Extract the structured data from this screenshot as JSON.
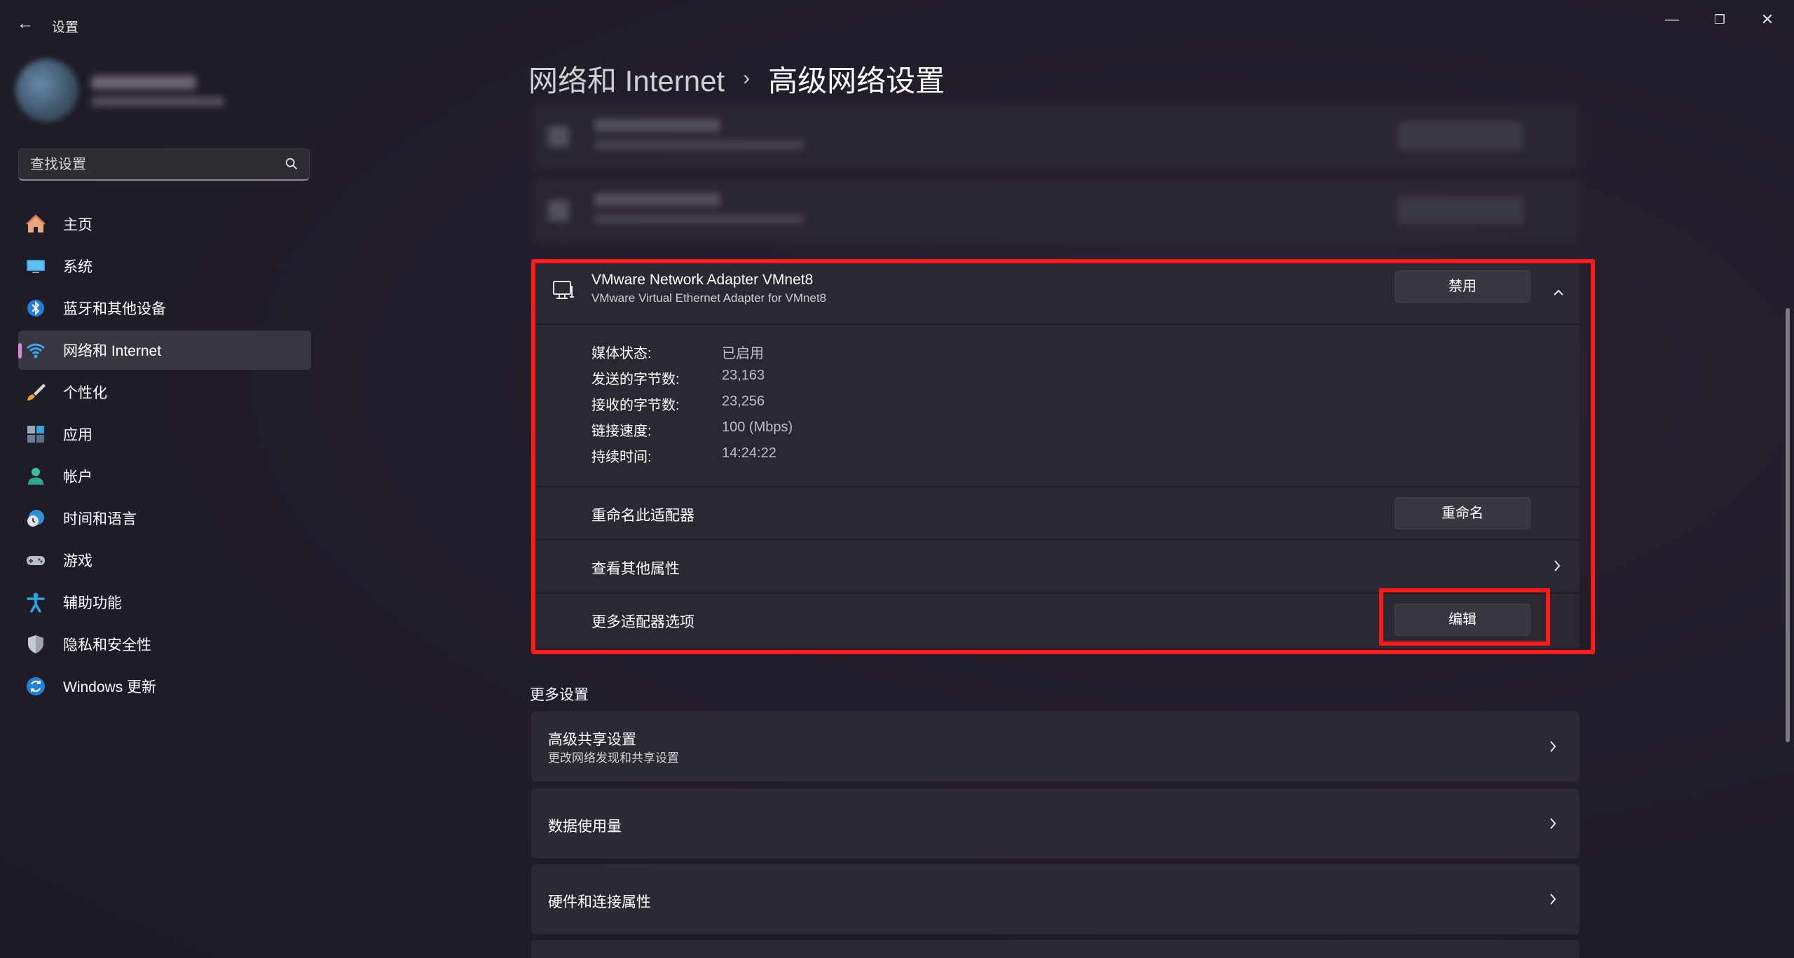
{
  "app": {
    "title": "设置",
    "back_icon": "arrow-left-icon"
  },
  "window_controls": {
    "minimize": "—",
    "maximize": "❐",
    "close": "✕"
  },
  "search": {
    "placeholder": "查找设置"
  },
  "sidebar": {
    "items": [
      {
        "label": "主页",
        "icon": "home-icon"
      },
      {
        "label": "系统",
        "icon": "system-icon"
      },
      {
        "label": "蓝牙和其他设备",
        "icon": "bluetooth-icon"
      },
      {
        "label": "网络和 Internet",
        "icon": "wifi-icon",
        "active": true
      },
      {
        "label": "个性化",
        "icon": "brush-icon"
      },
      {
        "label": "应用",
        "icon": "apps-icon"
      },
      {
        "label": "帐户",
        "icon": "account-icon"
      },
      {
        "label": "时间和语言",
        "icon": "time-language-icon"
      },
      {
        "label": "游戏",
        "icon": "gamepad-icon"
      },
      {
        "label": "辅助功能",
        "icon": "accessibility-icon"
      },
      {
        "label": "隐私和安全性",
        "icon": "shield-icon"
      },
      {
        "label": "Windows 更新",
        "icon": "update-icon"
      }
    ]
  },
  "breadcrumb": {
    "parent": "网络和 Internet",
    "separator": "›",
    "current": "高级网络设置"
  },
  "adapter": {
    "name": "VMware Network Adapter VMnet8",
    "description": "VMware Virtual Ethernet Adapter for VMnet8",
    "disable_label": "禁用",
    "properties": [
      {
        "label": "媒体状态:",
        "value": "已启用"
      },
      {
        "label": "发送的字节数:",
        "value": "23,163"
      },
      {
        "label": "接收的字节数:",
        "value": "23,256"
      },
      {
        "label": "链接速度:",
        "value": "100 (Mbps)"
      },
      {
        "label": "持续时间:",
        "value": "14:24:22"
      }
    ],
    "rename": {
      "label": "重命名此适配器",
      "button": "重命名"
    },
    "other_properties": {
      "label": "查看其他属性"
    },
    "more_options": {
      "label": "更多适配器选项",
      "button": "编辑"
    }
  },
  "more_settings": {
    "title": "更多设置",
    "items": [
      {
        "title": "高级共享设置",
        "subtitle": "更改网络发现和共享设置"
      },
      {
        "title": "数据使用量"
      },
      {
        "title": "硬件和连接属性"
      }
    ]
  },
  "colors": {
    "accent": "#d68cd7",
    "highlight": "#ff1a1a",
    "card": "#2c2832"
  }
}
